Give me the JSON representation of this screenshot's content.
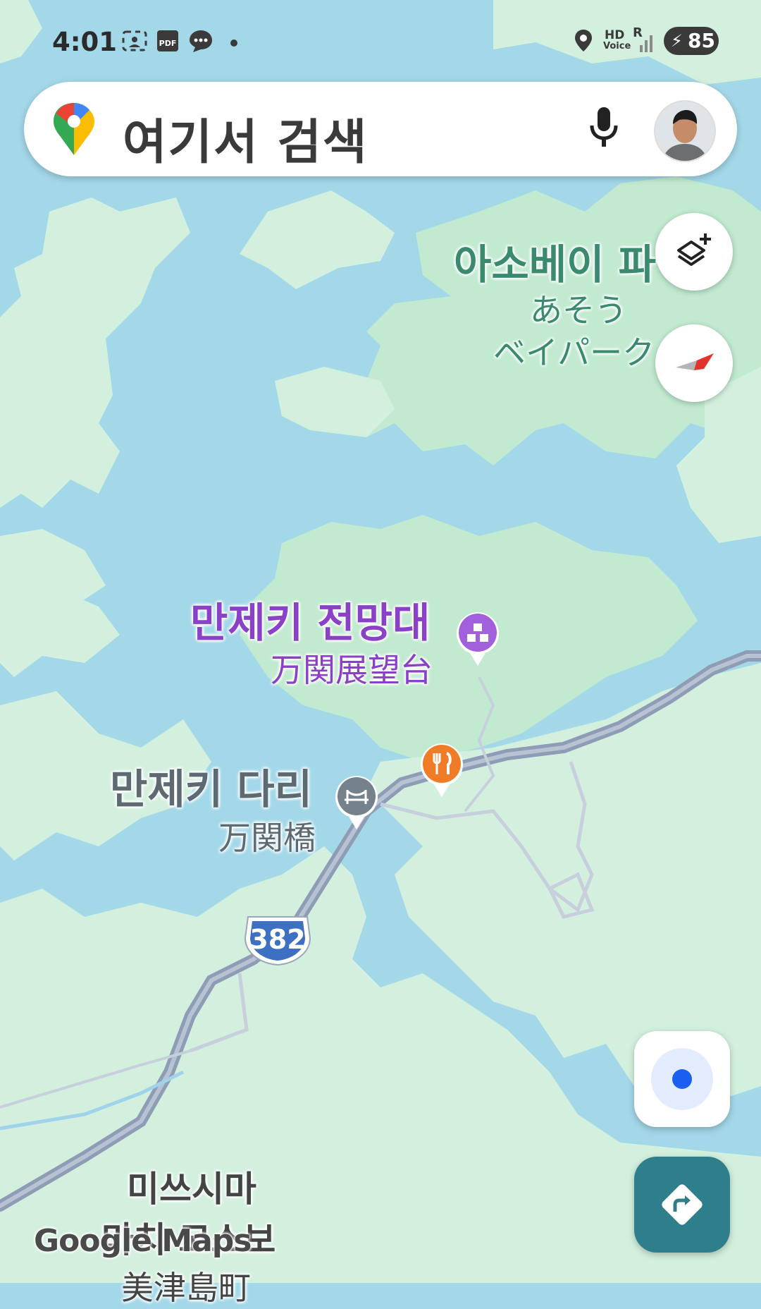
{
  "status_bar": {
    "time": "4:01",
    "hd_voice_top": "HD",
    "hd_voice_bottom": "Voice",
    "roaming": "R",
    "battery_percent": "85",
    "icons": [
      "screenshot-icon",
      "pdf-icon",
      "messenger-icon",
      "notification-dot-icon",
      "location-icon",
      "hd-voice-icon",
      "signal-icon",
      "battery-charging-icon"
    ]
  },
  "search": {
    "placeholder": "여기서 검색",
    "icons": [
      "google-maps-pin-icon",
      "microphone-icon",
      "profile-avatar"
    ]
  },
  "controls": {
    "layers_icon": "layers-plus-icon",
    "compass_icon": "compass-icon",
    "my_location_icon": "my-location-icon",
    "directions_icon": "directions-icon"
  },
  "places": {
    "park": {
      "ko": "아소베이 파",
      "ja_line1": "あそう",
      "ja_line2": "ベイパーク"
    },
    "observatory": {
      "ko": "만제키 전망대",
      "ja": "万関展望台",
      "icon": "observatory-icon"
    },
    "bridge": {
      "ko": "만제키 다리",
      "ja": "万関橋",
      "icon": "bridge-icon"
    },
    "restaurant": {
      "icon": "restaurant-icon"
    },
    "town": {
      "ko_line1": "미쓰시마",
      "ko_line2": "마치 고스보",
      "ja": "美津島町"
    }
  },
  "road": {
    "route_number": "382"
  },
  "watermark": "Google Maps",
  "colors": {
    "water": "#a3d8e9",
    "land": "#d3f0de",
    "park": "#c1ead0",
    "road": "#8e9db5",
    "route_shield": "#3d6fc2",
    "poi_purple": "#a261dc",
    "restaurant_orange": "#f07c28",
    "bridge_gray": "#75828c",
    "directions_teal": "#2e7e8c",
    "my_location_blue": "#1a5ff0"
  }
}
